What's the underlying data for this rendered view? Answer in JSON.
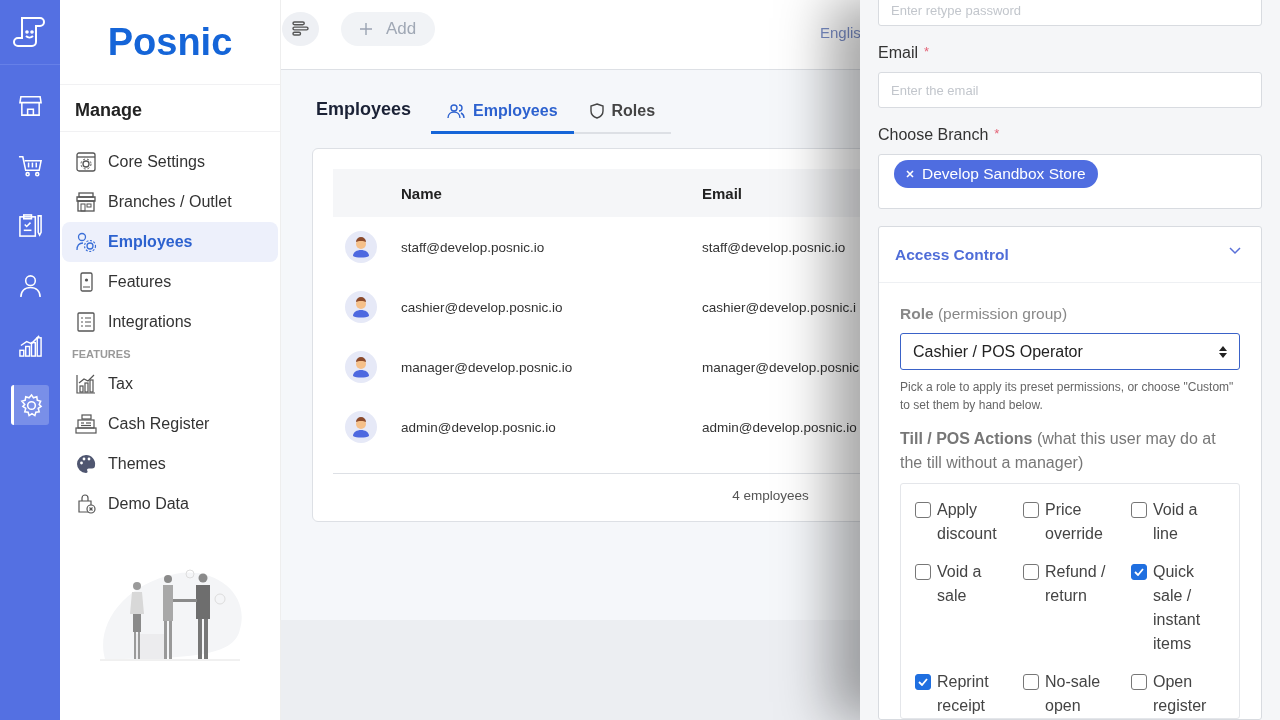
{
  "rail": {
    "items": [
      {
        "selected": false
      },
      {
        "selected": false
      },
      {
        "selected": false
      },
      {
        "selected": false
      },
      {
        "selected": false
      },
      {
        "selected": true
      }
    ]
  },
  "brand": "Posnic",
  "sidebar": {
    "title": "Manage",
    "items": [
      {
        "label": "Core Settings",
        "selected": false
      },
      {
        "label": "Branches / Outlet",
        "selected": false
      },
      {
        "label": "Employees",
        "selected": true
      },
      {
        "label": "Features",
        "selected": false
      },
      {
        "label": "Integrations",
        "selected": false
      }
    ],
    "section_heading": "FEATURES",
    "feature_items": [
      {
        "label": "Tax",
        "selected": false
      },
      {
        "label": "Cash Register",
        "selected": false
      },
      {
        "label": "Themes",
        "selected": false
      },
      {
        "label": "Demo Data",
        "selected": false
      }
    ]
  },
  "topbar": {
    "add_button": "Add",
    "language": "Englis"
  },
  "page": {
    "title": "Employees",
    "tabs": [
      {
        "label": "Employees",
        "selected": true
      },
      {
        "label": "Roles",
        "selected": false
      }
    ]
  },
  "table": {
    "columns": [
      "Name",
      "Email"
    ],
    "rows": [
      {
        "name": "staff@develop.posnic.io",
        "email": "staff@develop.posnic.io"
      },
      {
        "name": "cashier@develop.posnic.io",
        "email": "cashier@develop.posnic.i"
      },
      {
        "name": "manager@develop.posnic.io",
        "email": "manager@develop.posnic"
      },
      {
        "name": "admin@develop.posnic.io",
        "email": "admin@develop.posnic.io"
      }
    ],
    "footer": "4 employees"
  },
  "drawer": {
    "fields": [
      {
        "placeholder": "Enter retype password"
      },
      {
        "label": "Email",
        "required_mark": "*",
        "placeholder": "Enter the email"
      }
    ],
    "branch": {
      "label": "Choose Branch",
      "required_mark": "*",
      "tags": [
        "Develop Sandbox Store"
      ]
    },
    "access_control": {
      "title": "Access Control",
      "expanded": true,
      "role_label": "**Role** (permission group)",
      "role_value": "Cashier / POS Operator",
      "help": "Pick a role to apply its preset permissions, or choose \"Custom\" to set them by hand below.",
      "section_title": "**Till / POS Actions** (what this user may do at the till without a manager)",
      "permissions": [
        {
          "label": "Apply discount",
          "checked": false
        },
        {
          "label": "Price override",
          "checked": false
        },
        {
          "label": "Void a line",
          "checked": false
        },
        {
          "label": "Void a sale",
          "checked": false
        },
        {
          "label": "Refund / return",
          "checked": false
        },
        {
          "label": "Quick sale / instant items",
          "checked": true
        },
        {
          "label": "Reprint receipt",
          "checked": true
        },
        {
          "label": "No-sale open",
          "checked": false
        },
        {
          "label": "Open register",
          "checked": false
        }
      ]
    }
  }
}
